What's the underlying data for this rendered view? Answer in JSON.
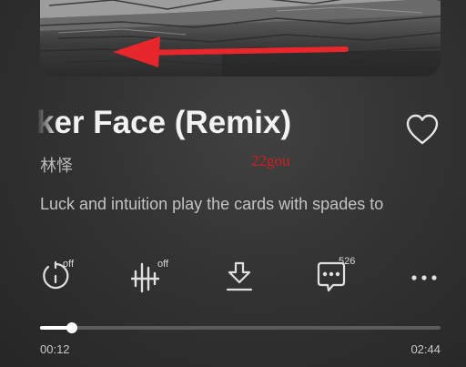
{
  "player": {
    "title": "ker Face (Remix)",
    "artist": "林怿",
    "watermark": "22gou",
    "lyric": "Luck and intuition play the cards with spades to",
    "favorite_icon": "heart-outline-icon",
    "accent_color": "#e8262b"
  },
  "actions": {
    "timer": {
      "icon": "timer-icon",
      "badge": "off"
    },
    "sound_effect": {
      "icon": "sound-effect-icon",
      "badge": "off"
    },
    "download": {
      "icon": "download-icon"
    },
    "comments": {
      "icon": "comment-icon",
      "count": "526"
    },
    "more": {
      "icon": "more-icon"
    }
  },
  "progress": {
    "elapsed": "00:12",
    "total": "02:44",
    "fraction": 0.08
  }
}
